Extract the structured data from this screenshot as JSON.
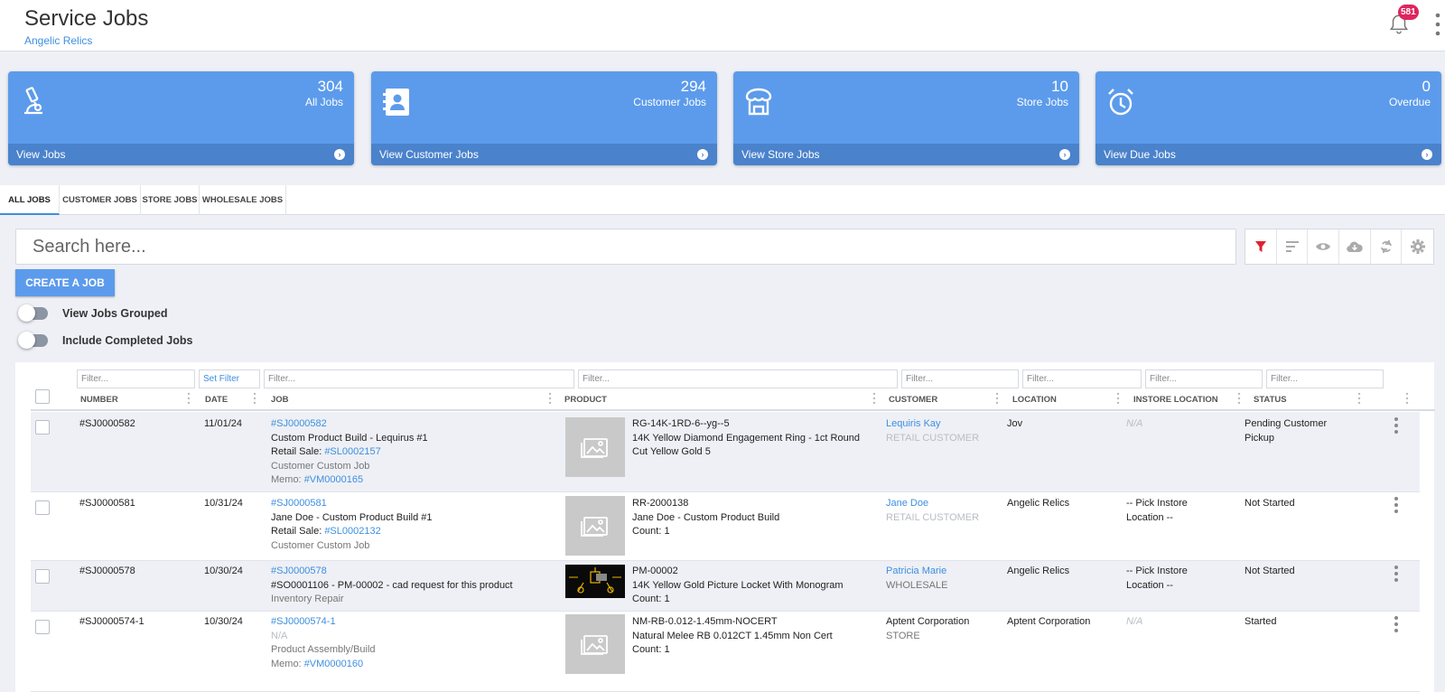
{
  "header": {
    "title": "Service Jobs",
    "subtitle": "Angelic Relics",
    "notification_count": "581"
  },
  "cards": [
    {
      "count": "304",
      "label": "All Jobs",
      "link": "View Jobs",
      "icon": "microscope-icon"
    },
    {
      "count": "294",
      "label": "Customer Jobs",
      "link": "View Customer Jobs",
      "icon": "contact-book-icon"
    },
    {
      "count": "10",
      "label": "Store Jobs",
      "link": "View Store Jobs",
      "icon": "store-icon"
    },
    {
      "count": "0",
      "label": "Overdue",
      "link": "View Due Jobs",
      "icon": "alarm-clock-icon"
    }
  ],
  "tabs": [
    "ALL JOBS",
    "CUSTOMER JOBS",
    "STORE JOBS",
    "WHOLESALE JOBS"
  ],
  "search": {
    "placeholder": "Search here..."
  },
  "toolbar": [
    "filter-icon",
    "sort-icon",
    "eye-icon",
    "cloud-download-icon",
    "refresh-icon",
    "settings-icon"
  ],
  "create_button": "CREATE A JOB",
  "toggles": [
    "View Jobs Grouped",
    "Include Completed Jobs"
  ],
  "filters": {
    "number": "Filter...",
    "date": "Set Filter",
    "job": "Filter...",
    "product": "Filter...",
    "customer": "Filter...",
    "location": "Filter...",
    "instore": "Filter...",
    "status": "Filter..."
  },
  "columns": [
    "NUMBER",
    "DATE",
    "JOB",
    "PRODUCT",
    "CUSTOMER",
    "LOCATION",
    "INSTORE LOCATION",
    "STATUS"
  ],
  "rows": [
    {
      "number": "#SJ0000582",
      "date": "11/01/24",
      "job_link": "#SJ0000582",
      "job_title": "Custom Product Build - Lequirus #1",
      "retail_label": "Retail Sale: ",
      "retail_link": "#SL0002157",
      "job_type": "Customer Custom Job",
      "memo_label": "Memo: ",
      "memo_link": "#VM0000165",
      "product_sku": "RG-14K-1RD-6--yg--5",
      "product_name": "14K Yellow Diamond Engagement Ring - 1ct Round Cut Yellow Gold 5",
      "product_count": "",
      "customer": "Lequiris Kay",
      "customer_type": "RETAIL CUSTOMER",
      "location": "Jov",
      "instore": "N/A",
      "status": "Pending Customer Pickup"
    },
    {
      "number": "#SJ0000581",
      "date": "10/31/24",
      "job_link": "#SJ0000581",
      "job_title": "Jane Doe - Custom Product Build #1",
      "retail_label": "Retail Sale: ",
      "retail_link": "#SL0002132",
      "job_type": "Customer Custom Job",
      "product_sku": "RR-2000138",
      "product_name": "Jane Doe - Custom Product Build",
      "product_count": "Count: 1",
      "customer": "Jane Doe",
      "customer_type": "RETAIL CUSTOMER",
      "location": "Angelic Relics",
      "instore": "-- Pick Instore Location --",
      "status": "Not Started"
    },
    {
      "number": "#SJ0000578",
      "date": "10/30/24",
      "job_link": "#SJ0000578",
      "job_title": "#SO0001106 - PM-00002 - cad request for this product",
      "job_type": "Inventory Repair",
      "product_sku": "PM-00002",
      "product_name": "14K Yellow Gold Picture Locket With Monogram",
      "product_count": "Count: 1",
      "customer": "Patricia Marie",
      "customer_type": "WHOLESALE",
      "location": "Angelic Relics",
      "instore": "-- Pick Instore Location --",
      "status": "Not Started"
    },
    {
      "number": "#SJ0000574-1",
      "date": "10/30/24",
      "job_link": "#SJ0000574-1",
      "job_title": "N/A",
      "job_type": "Product Assembly/Build",
      "memo_label": "Memo: ",
      "memo_link": "#VM0000160",
      "product_sku": "NM-RB-0.012-1.45mm-NOCERT",
      "product_name": "Natural Melee RB 0.012CT 1.45mm Non Cert",
      "product_count": "Count: 1",
      "customer": "Aptent Corporation",
      "customer_type": "STORE",
      "location": "Aptent Corporation",
      "instore": "N/A",
      "status": "Started"
    }
  ]
}
